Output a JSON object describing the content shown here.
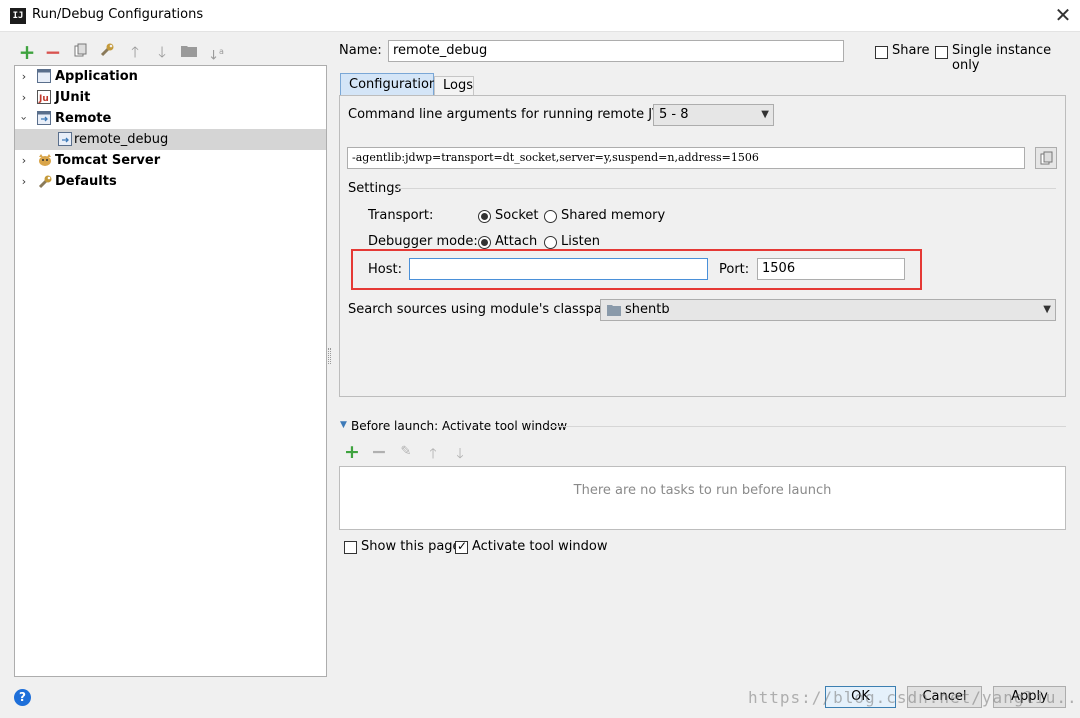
{
  "window": {
    "title": "Run/Debug Configurations",
    "app_icon_text": "IJ"
  },
  "toolbar": {
    "icons": [
      "add-icon",
      "remove-icon",
      "copy-icon",
      "wrench-icon",
      "move-up-icon",
      "move-down-icon",
      "folder-icon",
      "sort-icon"
    ]
  },
  "tree": {
    "items": [
      {
        "label": "Application",
        "expanded": false,
        "bold": true,
        "icon": "application-icon"
      },
      {
        "label": "JUnit",
        "expanded": false,
        "bold": true,
        "icon": "junit-icon"
      },
      {
        "label": "Remote",
        "expanded": true,
        "bold": true,
        "icon": "remote-icon"
      },
      {
        "label": "remote_debug",
        "child": true,
        "selected": true,
        "icon": "remote-config-icon"
      },
      {
        "label": "Tomcat Server",
        "expanded": false,
        "bold": true,
        "icon": "tomcat-icon"
      },
      {
        "label": "Defaults",
        "expanded": false,
        "bold": true,
        "icon": "defaults-icon"
      }
    ]
  },
  "form": {
    "name_label": "Name:",
    "name_value": "remote_debug",
    "share_label": "Share",
    "share_checked": false,
    "single_instance_label": "Single instance only",
    "single_instance_checked": false
  },
  "tabs": [
    {
      "label": "Configuration",
      "active": true
    },
    {
      "label": "Logs",
      "active": false
    }
  ],
  "config": {
    "cmd_label": "Command line arguments for running remote JVM",
    "jvm_version": "5 - 8",
    "cmd_value": "-agentlib:jdwp=transport=dt_socket,server=y,suspend=n,address=1506",
    "settings_label": "Settings",
    "transport_label": "Transport:",
    "transport_socket": "Socket",
    "transport_shared": "Shared memory",
    "debugger_label": "Debugger mode:",
    "debugger_attach": "Attach",
    "debugger_listen": "Listen",
    "host_label": "Host:",
    "host_value": "",
    "port_label": "Port:",
    "port_value": "1506",
    "classpath_label": "Search sources using module's classpath:",
    "classpath_value": "shentb"
  },
  "before_launch": {
    "title": "Before launch: Activate tool window",
    "icons": [
      "add-icon",
      "remove-icon",
      "edit-icon",
      "move-up-icon",
      "move-down-icon"
    ],
    "empty_text": "There are no tasks to run before launch",
    "show_page_label": "Show this page",
    "show_page_checked": false,
    "activate_label": "Activate tool window",
    "activate_checked": true
  },
  "buttons": {
    "ok": "OK",
    "cancel": "Cancel",
    "apply": "Apply"
  },
  "watermark": "https://blog.csdn.net/yangliu...in",
  "colors": {
    "highlight": "#e53935",
    "add_green": "#3fa33f",
    "remove_red": "#d9534f",
    "accent_blue": "#4a90d9"
  }
}
